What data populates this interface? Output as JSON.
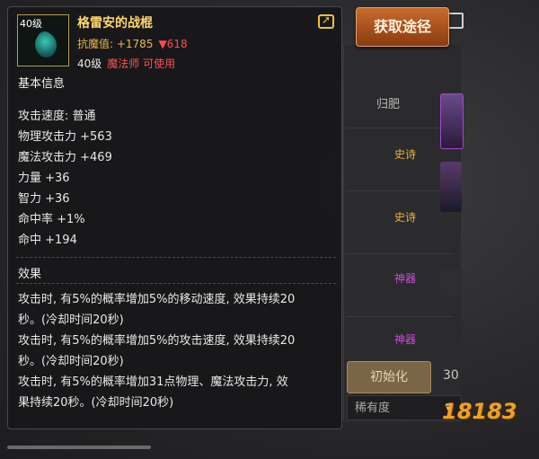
{
  "item": {
    "level_badge": "40级",
    "name": "格雷安的战棍",
    "resist_label": "抗魔值: +1785",
    "resist_down": "▼618",
    "req_level": "40级",
    "req_class": "魔法师 可使用"
  },
  "basic_info": {
    "title": "基本信息",
    "stats": [
      "攻击速度: 普通",
      "物理攻击力 +563",
      "魔法攻击力 +469",
      "力量 +36",
      "智力 +36",
      "命中率 +1%",
      "命中 +194"
    ]
  },
  "effects": {
    "title": "效果",
    "lines": [
      "攻击时, 有5%的概率增加5%的移动速度, 效果持续20",
      "秒。(冷却时间20秒)",
      "攻击时, 有5%的概率增加5%的攻击速度, 效果持续20",
      "秒。(冷却时间20秒)",
      "攻击时, 有5%的概率增加31点物理、魔法攻击力, 效",
      "果持续20秒。(冷却时间20秒)"
    ]
  },
  "acquire_button": "获取途径",
  "background": {
    "tab": "归肥",
    "tags": [
      "史诗",
      "史诗",
      "神器",
      "神器"
    ],
    "tag_colors": [
      "#e8b43a",
      "#e8b43a",
      "#d04adf",
      "#d04adf"
    ],
    "refine_button": "初始化",
    "number": "30",
    "select_value": "稀有度"
  },
  "logo": "18183"
}
